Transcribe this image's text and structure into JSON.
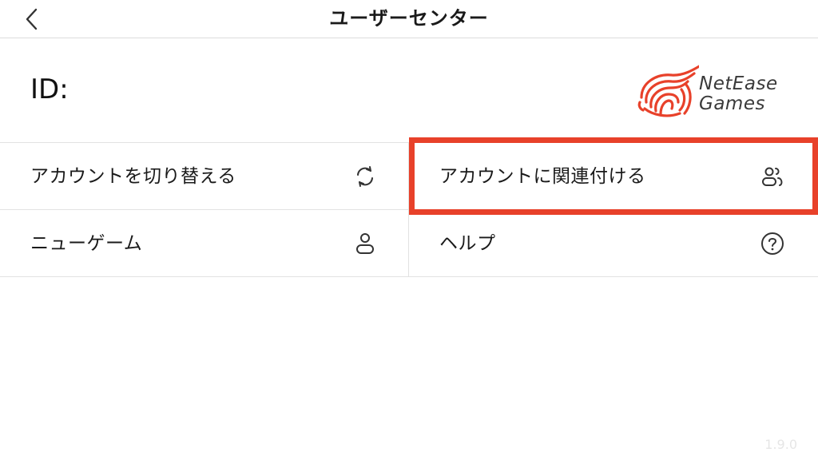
{
  "header": {
    "title": "ユーザーセンター",
    "back_icon": "chevron-left-icon"
  },
  "profile": {
    "id_label": "ID:"
  },
  "logo": {
    "line1": "NetEase",
    "line2": "Games",
    "brand_color": "#e8412a"
  },
  "menu": {
    "switch_account": {
      "label": "アカウントを切り替える",
      "icon": "refresh-icon"
    },
    "link_account": {
      "label": "アカウントに関連付ける",
      "icon": "link-users-icon"
    },
    "new_game": {
      "label": "ニューゲーム",
      "icon": "user-icon"
    },
    "help": {
      "label": "ヘルプ",
      "icon": "help-circle-icon"
    }
  },
  "highlight_color": "#e8412a",
  "version": "1.9.0"
}
